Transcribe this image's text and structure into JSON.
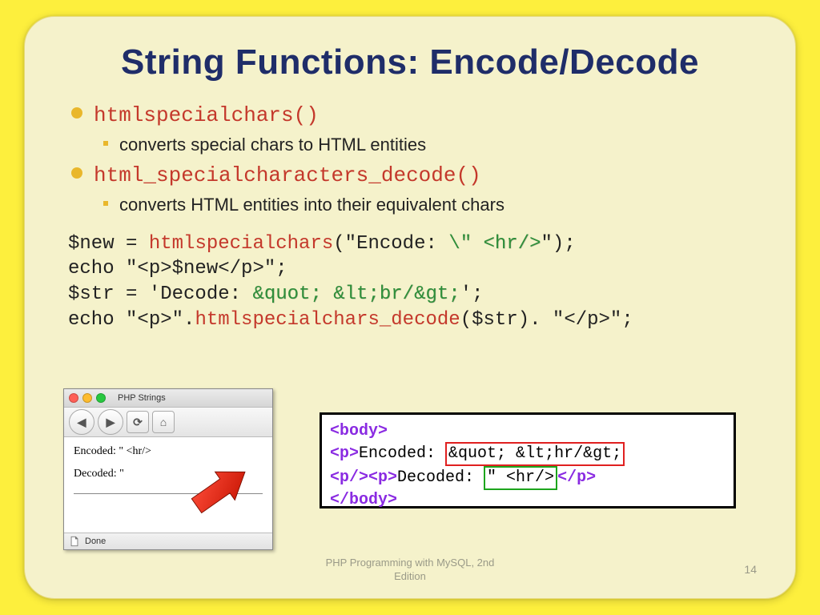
{
  "title": "String Functions: Encode/Decode",
  "bullets": {
    "item1": "htmlspecialchars()",
    "item1_sub": "converts special chars to HTML entities",
    "item2": "html_specialcharacters_decode()",
    "item2_sub": "converts HTML entities into their equivalent chars"
  },
  "code": {
    "l1a": "$new = ",
    "l1b": "htmlspecialchars",
    "l1c": "(\"Encode: ",
    "l1d": "\\\" <hr/>",
    "l1e": "\");",
    "l2": "echo \"<p>$new</p>\";",
    "l3a": "$str = 'Decode: ",
    "l3b": "&quot; &lt;br/&gt;",
    "l3c": "';",
    "l4a": "echo \"<p>\".",
    "l4b": "htmlspecialchars_decode",
    "l4c": "($str). \"</p>\";"
  },
  "browser": {
    "tab_title": "PHP Strings",
    "line1": "Encoded: \" <hr/>",
    "line2": "Decoded: \"",
    "status_done": "Done"
  },
  "source": {
    "body_open": "<body>",
    "p_open": "<p>",
    "enc_label": "Encoded: ",
    "enc_entities": "&quot; &lt;hr/&gt;",
    "p_close_open": "<p/><p>",
    "dec_label": "Decoded: ",
    "dec_raw": "\" <hr/>",
    "p_close": "</p>",
    "body_close": "</body>"
  },
  "footer": {
    "line1": "PHP Programming with MySQL, 2nd",
    "line2": "Edition"
  },
  "page_number": "14"
}
